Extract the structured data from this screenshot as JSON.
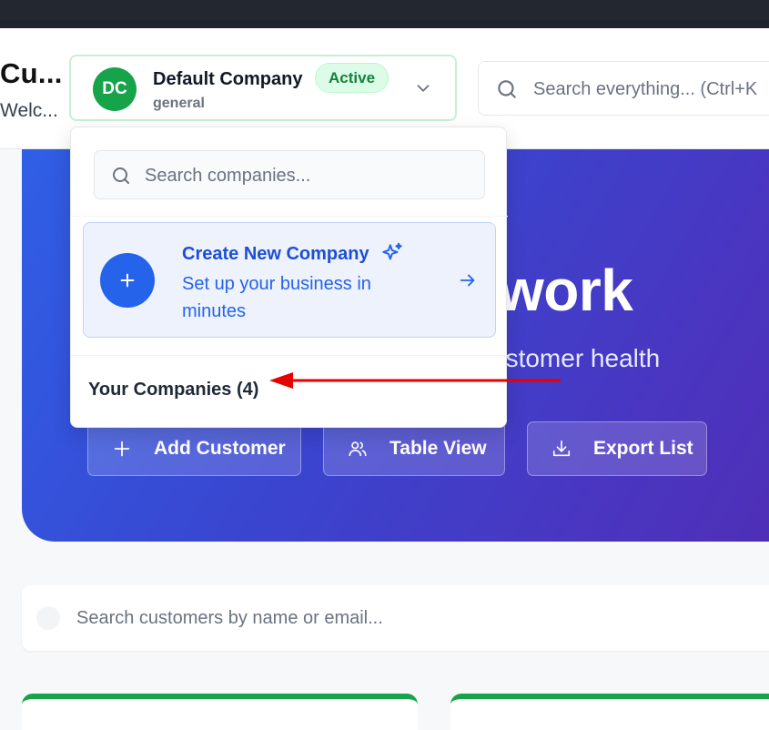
{
  "header": {
    "title": "Cu...",
    "subtitle": "Welc..."
  },
  "company_switcher": {
    "avatar_initials": "DC",
    "name": "Default Company",
    "category": "general",
    "status_badge": "Active"
  },
  "global_search": {
    "placeholder": "Search everything... (Ctrl+K"
  },
  "hero": {
    "title_fragment": "work",
    "subtitle_fragment": "ustomer health",
    "buttons": {
      "add_customer": "Add Customer",
      "table_view": "Table View",
      "export_list": "Export List"
    }
  },
  "customer_search": {
    "placeholder": "Search customers by name or email..."
  },
  "company_dropdown": {
    "search_placeholder": "Search companies...",
    "create": {
      "title": "Create New Company",
      "description": "Set up your business in minutes"
    },
    "companies_heading": "Your Companies (4)"
  },
  "colors": {
    "accent_blue": "#2563eb",
    "brand_green": "#16a34a",
    "annotation_red": "#e60000"
  },
  "icons": [
    "search-icon",
    "chevron-down-icon",
    "plus-icon",
    "sparkle-icon",
    "arrow-right-icon",
    "users-icon",
    "download-icon"
  ]
}
